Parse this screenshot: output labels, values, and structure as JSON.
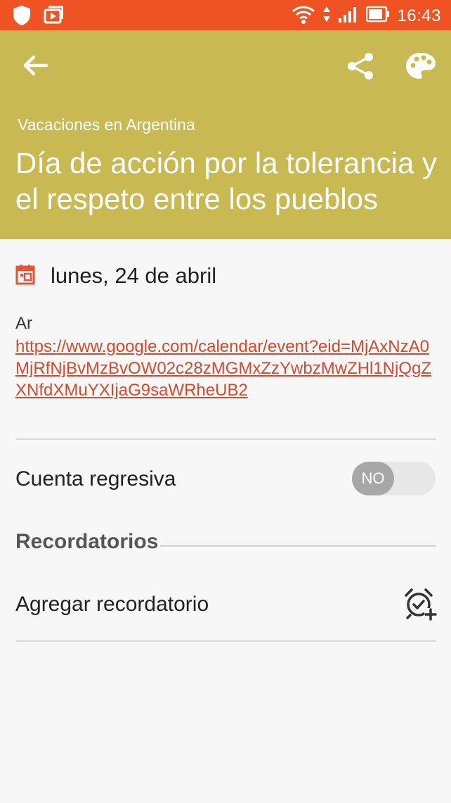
{
  "status_bar": {
    "time": "16:43",
    "icons": [
      "shield-icon",
      "media-play-icon",
      "wifi-icon",
      "data-arrows-icon",
      "signal-icon",
      "battery-icon"
    ]
  },
  "header": {
    "calendar_name": "Vacaciones en Argentina",
    "event_title": "Día de acción por la tolerancia y el respeto entre los pueblos",
    "background_color": "#c8b953",
    "actions": [
      "back-arrow-icon",
      "share-icon",
      "palette-icon"
    ]
  },
  "event": {
    "date": "lunes, 24 de abril",
    "description_prefix": "Ar",
    "link": "https://www.google.com/calendar/event?eid=MjAxNzA0MjRfNjBvMzBvOW02c28zMGMxZzYwbzMwZHl1NjQgZXNfdXMuYXIjaG9saWRheUB2"
  },
  "countdown": {
    "label": "Cuenta regresiva",
    "toggle_text": "NO",
    "enabled": false
  },
  "reminders": {
    "section_title": "Recordatorios",
    "add_label": "Agregar recordatorio"
  },
  "colors": {
    "status_bar": "#ef5323",
    "link": "#d9492c",
    "accent_icon": "#e6553a"
  }
}
